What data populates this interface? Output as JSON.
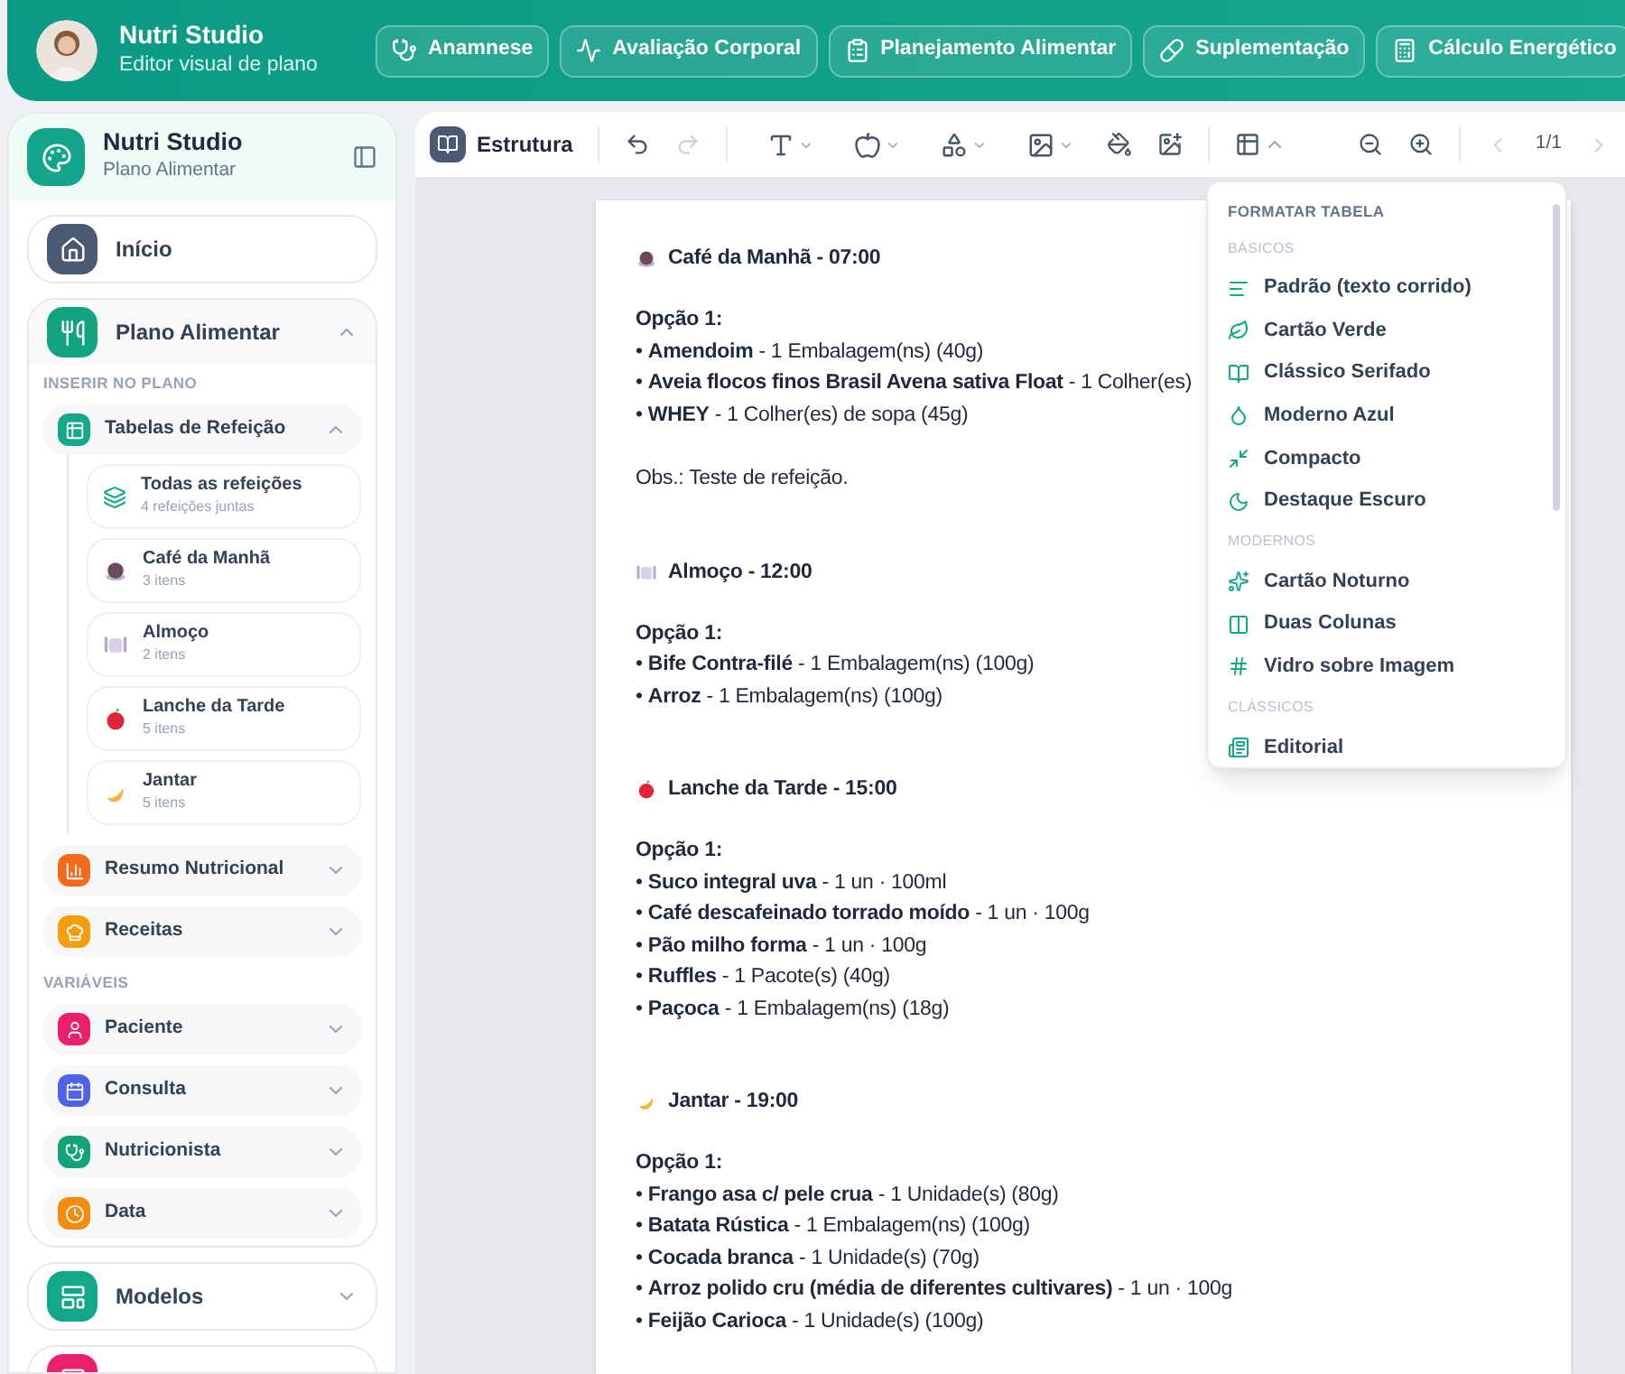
{
  "header": {
    "title": "Nutri Studio",
    "subtitle": "Editor visual de plano",
    "nav": [
      "Anamnese",
      "Avaliação Corporal",
      "Planejamento Alimentar",
      "Suplementação",
      "Cálculo Energético"
    ]
  },
  "sidebar": {
    "title": "Nutri Studio",
    "subtitle": "Plano Alimentar",
    "items": [
      {
        "kind": "link",
        "label": "Início",
        "color": "#4b5a72"
      },
      {
        "kind": "group",
        "label": "Plano Alimentar",
        "color": "#10a37f",
        "expanded": true,
        "sections": [
          {
            "heading": "INSERIR NO PLANO",
            "entries": [
              {
                "label": "Tabelas de Refeição",
                "color": "#14a88a",
                "expanded": true,
                "children": [
                  {
                    "kind": "all",
                    "label": "Todas as refeições",
                    "sub": "4 refeições juntas"
                  },
                  {
                    "kind": "meal",
                    "label": "Café da Manhã",
                    "sub": "3 itens"
                  },
                  {
                    "kind": "meal",
                    "label": "Almoço",
                    "sub": "2 itens"
                  },
                  {
                    "kind": "meal",
                    "label": "Lanche da Tarde",
                    "sub": "5 itens"
                  },
                  {
                    "kind": "meal",
                    "label": "Jantar",
                    "sub": "5 itens"
                  }
                ]
              },
              {
                "label": "Resumo Nutricional",
                "color": "#f26b1d",
                "expanded": false
              },
              {
                "label": "Receitas",
                "color": "#f59e0b",
                "expanded": false
              }
            ]
          },
          {
            "heading": "VARIÁVEIS",
            "entries": [
              {
                "label": "Paciente",
                "color": "#ec1f6b",
                "expanded": false
              },
              {
                "label": "Consulta",
                "color": "#4f62e8",
                "expanded": false
              },
              {
                "label": "Nutricionista",
                "color": "#12a37a",
                "expanded": false
              },
              {
                "label": "Data",
                "color": "#f58a0b",
                "expanded": false
              }
            ]
          }
        ]
      },
      {
        "kind": "group",
        "label": "Modelos",
        "color": "#14a88a",
        "expanded": false
      },
      {
        "kind": "group",
        "color": "#ec1f6b"
      }
    ]
  },
  "toolbar": {
    "label": "Estrutura",
    "page": "1/1",
    "table_menu_open": true
  },
  "document": {
    "meals": [
      {
        "title": "Café da Manhã - 07:00",
        "option": "Opção 1:",
        "items": [
          "• **Amendoim** - 1 Embalagem(ns) (40g)",
          "• **Aveia flocos finos Brasil Avena sativa Float** - 1 Colher(es)",
          "• **WHEY** - 1 Colher(es) de sopa (45g)"
        ],
        "note": "Obs.: Teste de refeição."
      },
      {
        "title": "Almoço - 12:00",
        "option": "Opção 1:",
        "items": [
          "• **Bife Contra-filé** - 1 Embalagem(ns) (100g)",
          "• **Arroz** - 1 Embalagem(ns) (100g)"
        ]
      },
      {
        "title": "Lanche da Tarde - 15:00",
        "option": "Opção 1:",
        "items": [
          "• **Suco integral uva** - 1 un · 100ml",
          "• **Café descafeinado torrado moído** - 1 un · 100g",
          "• **Pão milho forma** - 1 un · 100g",
          "• **Ruffles** - 1 Pacote(s) (40g)",
          "• **Paçoca** - 1 Embalagem(ns) (18g)"
        ]
      },
      {
        "title": "Jantar - 19:00",
        "option": "Opção 1:",
        "items": [
          "• **Frango asa c/ pele crua** - 1 Unidade(s) (80g)",
          "• **Batata Rústica** - 1 Embalagem(ns) (100g)",
          "• **Cocada branca** - 1 Unidade(s) (70g)",
          "• **Arroz polido cru (média de diferentes cultivares)** - 1 un · 100g",
          "• **Feijão Carioca** - 1 Unidade(s) (100g)"
        ]
      }
    ]
  },
  "table_menu": {
    "title": "FORMATAR TABELA",
    "sections": [
      {
        "heading": "BÁSICOS",
        "items": [
          "Padrão (texto corrido)",
          "Cartão Verde",
          "Clássico Serifado",
          "Moderno Azul",
          "Compacto",
          "Destaque Escuro"
        ]
      },
      {
        "heading": "MODERNOS",
        "items": [
          "Cartão Noturno",
          "Duas Colunas",
          "Vidro sobre Imagem"
        ]
      },
      {
        "heading": "CLÁSSICOS",
        "items": [
          "Editorial"
        ]
      }
    ]
  }
}
